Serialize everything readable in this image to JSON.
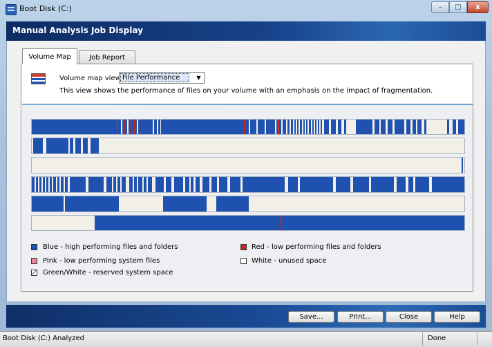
{
  "window": {
    "title": "Boot Disk (C:)",
    "controls": {
      "minimize": "–",
      "maximize": "□",
      "close": "x"
    }
  },
  "header": {
    "title": "Manual Analysis Job Display"
  },
  "tabs": [
    {
      "label": "Volume Map",
      "active": true
    },
    {
      "label": "Job Report",
      "active": false
    }
  ],
  "volume_map": {
    "view_label": "Volume map view:",
    "view_selected": "File Performance",
    "description": "This view shows the performance of files on your volume with an emphasis on the impact of fragmentation."
  },
  "legend": [
    {
      "label": "Blue - high performing files and folders",
      "color": "#1f52b0"
    },
    {
      "label": "Red - low performing files and folders",
      "color": "#c9271b"
    },
    {
      "label": "Pink - low performing system files",
      "color": "#e9849b"
    },
    {
      "label": "White - unused space",
      "color": "#ffffff"
    },
    {
      "label": "Green/White - reserved system space",
      "color": "#7fbf6a"
    }
  ],
  "buttons": {
    "save": "Save...",
    "print": "Print...",
    "close": "Close",
    "help": "Help"
  },
  "statusbar": {
    "text": "Boot Disk (C:) Analyzed",
    "state": "Done"
  },
  "colors": {
    "blue": "#1f52b0",
    "red": "#c9271b",
    "free": "#f2efe9"
  }
}
